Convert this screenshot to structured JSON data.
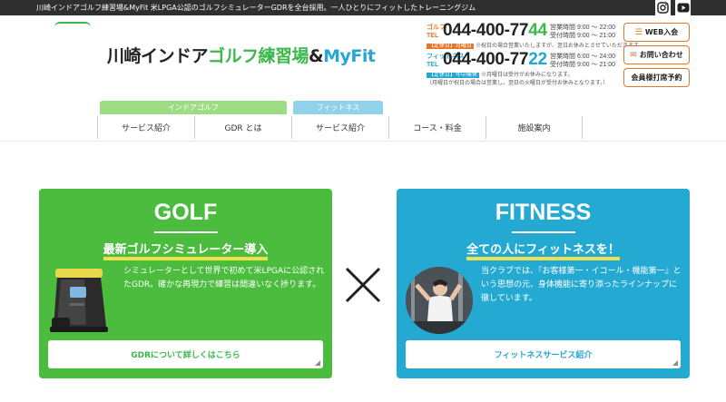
{
  "topbar": {
    "tagline": "川崎インドアゴルフ練習場&MyFit 米LPGA公認のゴルフシミュレーターGDRを全台採用。一人ひとりにフィットしたトレーニングジム"
  },
  "social": {
    "instagram_icon": "instagram-icon",
    "youtube_icon": "youtube-icon"
  },
  "logo": {
    "part1": "川崎インドア",
    "part2": "ゴルフ練習場",
    "amp": "&",
    "part3": "MyFit"
  },
  "contact": {
    "golf": {
      "label1": "ゴルフ",
      "label2": "TEL",
      "number_main": "044-400-77",
      "number_last": "44",
      "hours1": "営業時間 9:00 ～ 22:00",
      "hours2": "受付時間 9:00 ～ 21:00",
      "closed_tag": "【定休日】月曜日",
      "closed_note": "※祝日の場合営業いたしますが、翌日お休みとさせていただきます。"
    },
    "fitness": {
      "label1": "フィットネス",
      "label2": "TEL",
      "number_main": "044-400-77",
      "number_last": "22",
      "hours1": "営業時間 6:00 ～ 24:00",
      "hours2": "受付時間 9:00 ～ 21:00",
      "closed_tag": "【定休日】年中無休",
      "closed_note": "※月曜日は受付がお休みになります。",
      "closed_note2": "（月曜日が祝日の場合は営業し、翌日の火曜日が受付お休みとなります。）"
    }
  },
  "header_buttons": [
    {
      "label": "WEB入会",
      "icon": "form-icon"
    },
    {
      "label": "お問い合わせ",
      "icon": "mail-icon"
    },
    {
      "label": "会員様打席予約",
      "icon": ""
    }
  ],
  "nav": {
    "golf_tab": "インドアゴルフ",
    "fitness_tab": "フィットネス",
    "items": [
      "サービス紹介",
      "GDR とは",
      "サービス紹介",
      "コース・料金",
      "施設案内"
    ]
  },
  "cards": {
    "golf": {
      "title": "GOLF",
      "subtitle": "最新ゴルフシミュレーター導入",
      "body": "シミュレーターとして世界で初めて米LPGAに公認されたGDR。確かな再現力で練習は間違いなく捗ります。",
      "button": "GDRについて詳しくはこちら",
      "image": "golf-simulator-image",
      "color": "#4cbc3f"
    },
    "fitness": {
      "title": "FITNESS",
      "subtitle": "全ての人にフィットネスを！",
      "body": "当クラブでは、『お客様第一・イコール・機能第一』という思想の元、身体機能に寄り添ったラインナップに徹しています。",
      "button": "フィットネスサービス紹介",
      "image": "fitness-training-photo",
      "color": "#24aad2"
    }
  },
  "cross_icon": "cross-icon",
  "colors": {
    "golf_green": "#3bb84a",
    "fitness_blue": "#27a6d2",
    "accent_orange": "#e0772b",
    "underline_yellow": "#f1e04d"
  }
}
